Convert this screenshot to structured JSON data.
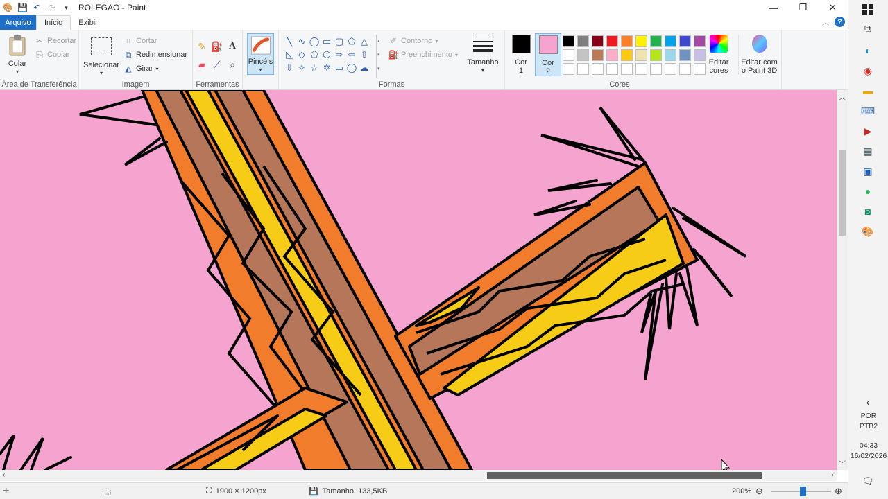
{
  "window": {
    "title": "ROLEGAO - Paint",
    "controls": {
      "minimize": "—",
      "restore": "❐",
      "close": "✕"
    }
  },
  "tabs": {
    "file": "Arquivo",
    "home": "Início",
    "view": "Exibir"
  },
  "ribbon": {
    "clipboard": {
      "label": "Área de Transferência",
      "paste": "Colar",
      "cut": "Recortar",
      "copy": "Copiar"
    },
    "image": {
      "label": "Imagem",
      "select": "Selecionar",
      "crop": "Cortar",
      "resize": "Redimensionar",
      "rotate": "Girar"
    },
    "tools": {
      "label": "Ferramentas"
    },
    "brushes": {
      "label": "Pincéis"
    },
    "shapes": {
      "label": "Formas",
      "outline": "Contorno",
      "fill": "Preenchimento"
    },
    "size": {
      "label": "Tamanho"
    },
    "colors": {
      "label": "Cores",
      "color1": "Cor 1",
      "color2": "Cor 2",
      "color1_value": "#000000",
      "color2_value": "#f5a3cf",
      "edit": "Editar cores",
      "paint3d": "Editar com o Paint 3D",
      "palette": [
        "#000000",
        "#7f7f7f",
        "#880015",
        "#ed1c24",
        "#ff7f27",
        "#fff200",
        "#22b14c",
        "#00a2e8",
        "#3f48cc",
        "#a349a4",
        "#ffffff",
        "#c3c3c3",
        "#b97a57",
        "#ffaec9",
        "#ffc90e",
        "#efe4b0",
        "#b5e61d",
        "#99d9ea",
        "#7092be",
        "#c8bfe7",
        "#ffffff",
        "#ffffff",
        "#ffffff",
        "#ffffff",
        "#ffffff",
        "#ffffff",
        "#ffffff",
        "#ffffff",
        "#ffffff",
        "#ffffff"
      ]
    }
  },
  "canvas": {
    "background": "#f5a3cf"
  },
  "status": {
    "dimensions": "1900 × 1200px",
    "size": "Tamanho: 133,5KB",
    "zoom": "200%"
  },
  "taskbar": {
    "lang1": "POR",
    "lang2": "PTB2",
    "time": "04:33",
    "date": "16/02/2026"
  }
}
